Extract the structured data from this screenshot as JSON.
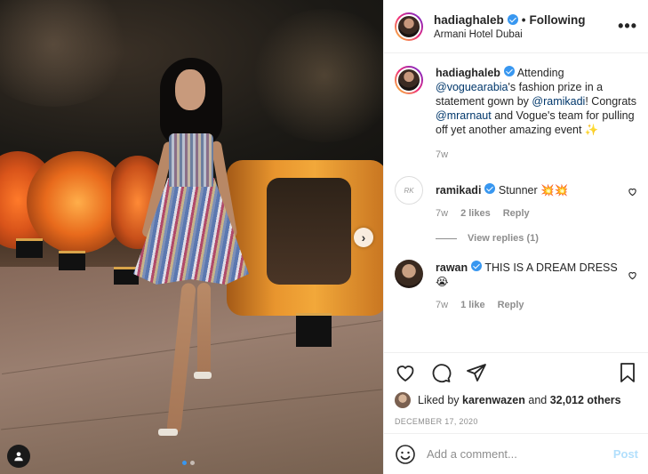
{
  "post": {
    "username": "hadiaghaleb",
    "follow_sep": "•",
    "follow_status": "Following",
    "location": "Armani Hotel Dubai",
    "more_label": "•••"
  },
  "caption": {
    "username": "hadiaghaleb",
    "text_1": " Attending ",
    "mention_1": "@voguearabia",
    "text_2": "'s fashion prize in a statement gown by ",
    "mention_2": "@ramikadi",
    "text_3": "! Congrats ",
    "mention_3": "@mrarnaut",
    "text_4": " and Vogue's team for pulling off yet another amazing event ✨",
    "time": "7w"
  },
  "comments": [
    {
      "username": "ramikadi",
      "text": " Stunner 💥💥",
      "time": "7w",
      "likes": "2 likes",
      "reply": "Reply",
      "view_replies": "View replies (1)"
    },
    {
      "username": "rawan",
      "text": " THIS IS A DREAM DRESS😭",
      "time": "7w",
      "likes": "1 like",
      "reply": "Reply"
    }
  ],
  "likes": {
    "prefix": "Liked by ",
    "user": "karenwazen",
    "middle": " and ",
    "others": "32,012 others"
  },
  "date": "DECEMBER 17, 2020",
  "comment_box": {
    "placeholder": "Add a comment...",
    "post_label": "Post"
  },
  "carousel": {
    "next_symbol": "›",
    "current_index": 1,
    "total": 2
  },
  "colors": {
    "verified": "#3897f0",
    "mention": "#00376b",
    "muted": "#8e8e8e",
    "post_disabled": "#b2dffc"
  }
}
